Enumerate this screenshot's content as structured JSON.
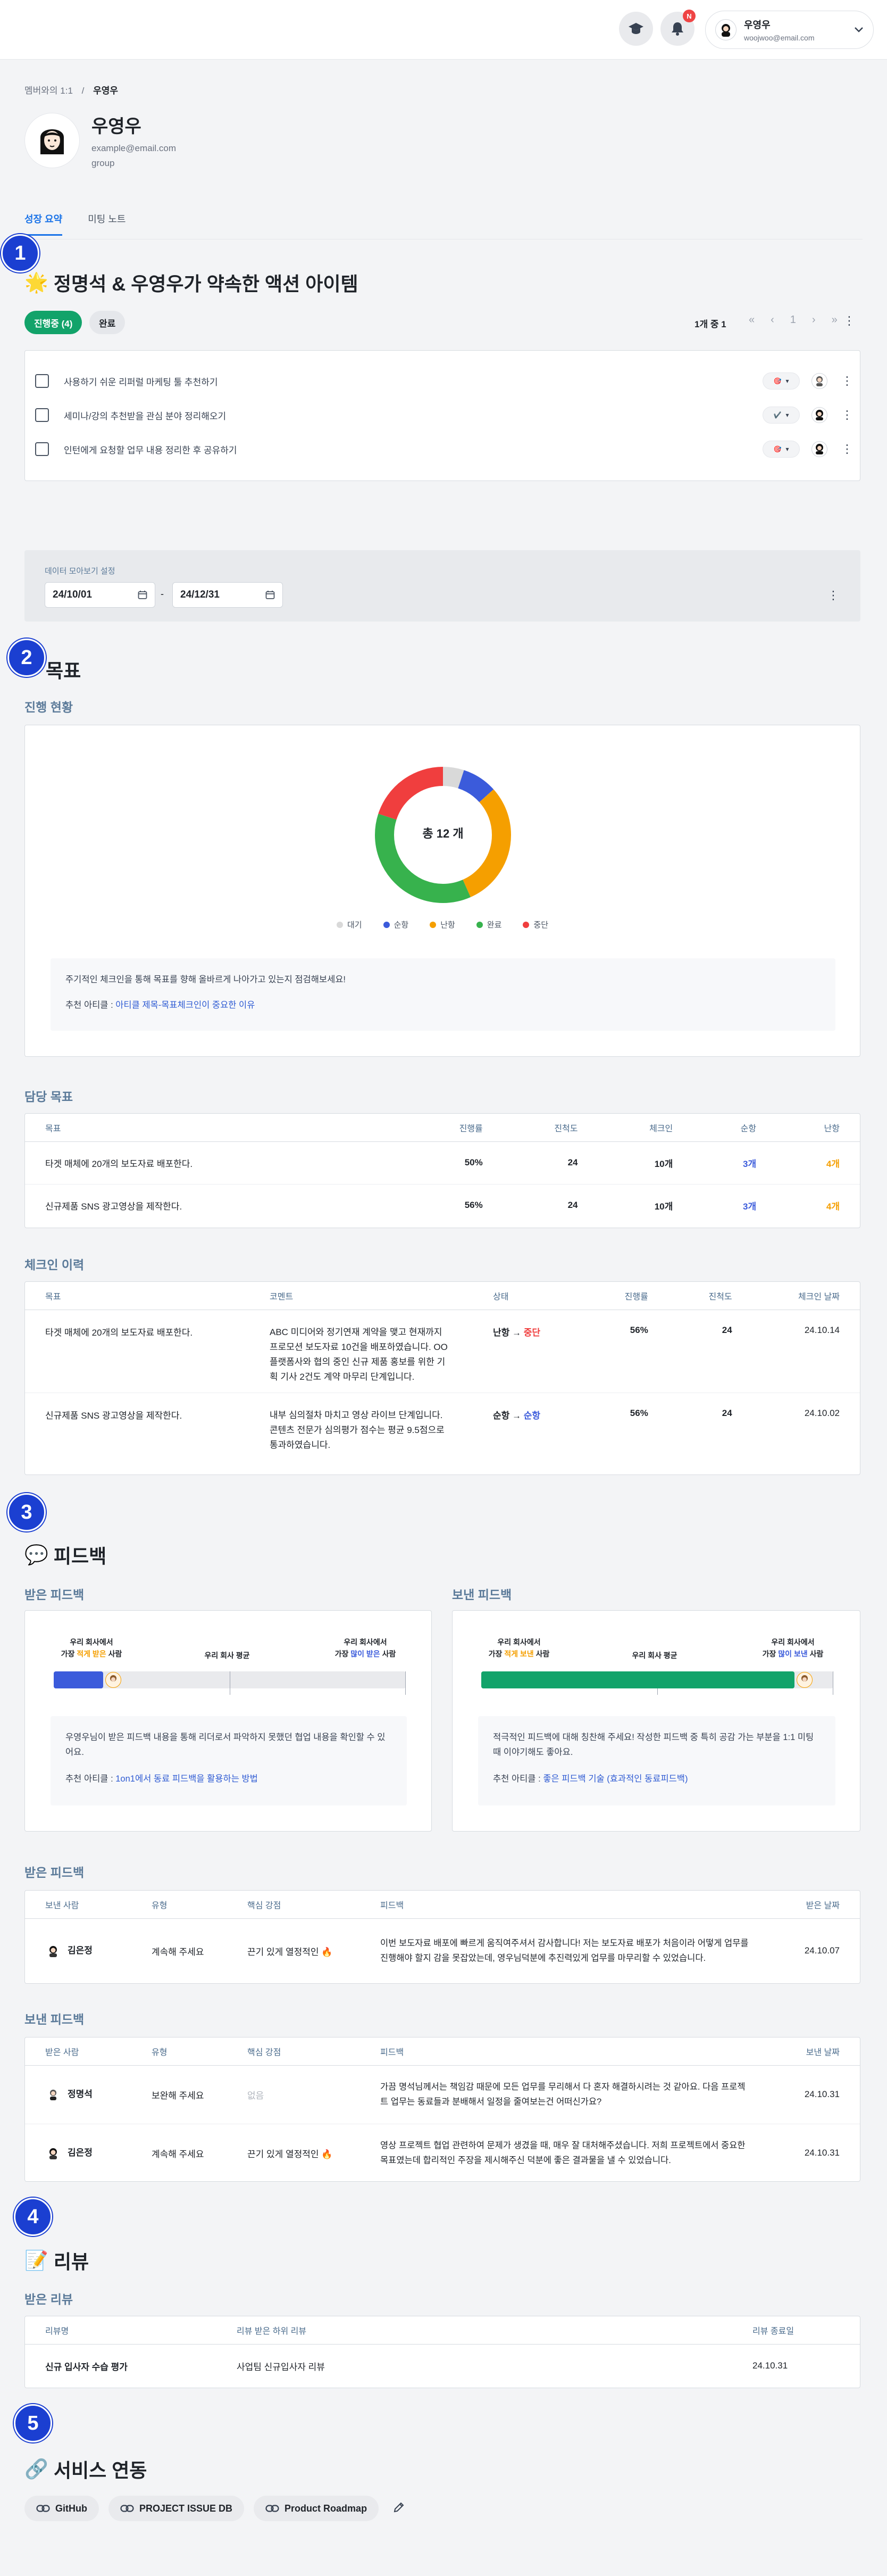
{
  "header": {
    "notification_count": "N",
    "user_name": "우영우",
    "user_email": "woojwoo@email.com"
  },
  "breadcrumb": {
    "parent": "멤버와의 1:1",
    "separator": "/",
    "current": "우영우"
  },
  "profile": {
    "name": "우영우",
    "email": "example@email.com",
    "group": "group"
  },
  "tabs": [
    {
      "label": "성장 요약",
      "active": true
    },
    {
      "label": "미팅 노트",
      "active": false
    }
  ],
  "badges": [
    "1",
    "2",
    "3",
    "4",
    "5"
  ],
  "actions": {
    "emoji": "🌟",
    "title": "정명석 & 우영우가 약속한 액션 아이템",
    "filter_in_progress": "진행중 (4)",
    "filter_done": "완료",
    "pager_info": "1개 중 1",
    "pager_first": "«",
    "pager_prev": "‹",
    "pager_page": "1",
    "pager_next": "›",
    "pager_last": "»",
    "items": [
      {
        "text": "사용하기 쉬운 리퍼럴 마케팅 툴 추천하기",
        "status_emoji": "🎯",
        "status_color": "#ef4444"
      },
      {
        "text": "세미나/강의 추천받을 관심 분야 정리해오기",
        "status_emoji": "✔️",
        "status_color": "#22a55b"
      },
      {
        "text": "인턴에게 요청할 업무 내용 정리한 후 공유하기",
        "status_emoji": "🎯",
        "status_color": "#ef4444"
      }
    ]
  },
  "data_view": {
    "label": "데이터 모아보기 설정",
    "start_date": "24/10/01",
    "separator": "-",
    "end_date": "24/12/31"
  },
  "goals": {
    "title": "목표",
    "progress_title": "진행 현황",
    "donut_center": "총 12 개",
    "legend": [
      {
        "name": "대기",
        "color": "#d9d9d9"
      },
      {
        "name": "순항",
        "color": "#3b5bdb"
      },
      {
        "name": "난항",
        "color": "#f59f00"
      },
      {
        "name": "완료",
        "color": "#37b24d"
      },
      {
        "name": "중단",
        "color": "#f03e3e"
      }
    ],
    "tip_text": "주기적인 체크인을 통해 목표를 향해 올바르게 나아가고 있는지 점검해보세요!",
    "tip_rec_label": "추천 아티클 : ",
    "tip_rec_link": "아티클 제목-목표체크인이 중요한 이유",
    "assigned_title": "담당 목표",
    "assigned_headers": [
      "목표",
      "진행률",
      "진척도",
      "체크인",
      "순항",
      "난항"
    ],
    "assigned_rows": [
      {
        "goal": "타겟 매체에 20개의 보도자료 배포한다.",
        "progress": "50%",
        "score": "24",
        "checkins": "10개",
        "smooth": "3개",
        "rough": "4개"
      },
      {
        "goal": "신규제품 SNS 광고영상을 제작한다.",
        "progress": "56%",
        "score": "24",
        "checkins": "10개",
        "smooth": "3개",
        "rough": "4개"
      }
    ],
    "checkin_title": "체크인 이력",
    "checkin_headers": [
      "목표",
      "코멘트",
      "상태",
      "진행률",
      "진척도",
      "체크인 날짜"
    ],
    "checkin_rows": [
      {
        "goal": "타겟 매체에 20개의 보도자료 배포한다.",
        "comment": "ABC 미디어와 정기연재 계약을 맺고 현재까지 프로모션 보도자료 10건을 배포하였습니다. OO플랫폼사와 협의 중인 신규 제품 홍보를 위한 기획 기사 2건도 계약 마무리 단계입니다.",
        "from": "난항",
        "arrow": "→",
        "to": "중단",
        "progress": "56%",
        "score": "24",
        "date": "24.10.14"
      },
      {
        "goal": "신규제품 SNS 광고영상을 제작한다.",
        "comment": "내부 심의절차 마치고 영상 라이브 단계입니다. 콘텐츠 전문가 심의평가 점수는 평균 9.5점으로 통과하였습니다.",
        "from": "순항",
        "arrow": "→",
        "to": "순항",
        "progress": "56%",
        "score": "24",
        "date": "24.10.02"
      }
    ]
  },
  "feedback": {
    "emoji": "💬",
    "title": "피드백",
    "received_title": "받은 피드백",
    "sent_title": "보낸 피드백",
    "received_bar": {
      "left_label_1": "우리 회사에서",
      "left_label_2a": "가장 ",
      "left_label_2b": "적게 받은",
      "left_label_2c": " 사람",
      "mid_label": "우리 회사 평균",
      "right_label_1": "우리 회사에서",
      "right_label_2a": "가장 ",
      "right_label_2b": "많이 받은",
      "right_label_2c": " 사람",
      "fill_fraction": 0.14,
      "color": "#3b5bdb"
    },
    "sent_bar": {
      "left_label_1": "우리 회사에서",
      "left_label_2a": "가장 ",
      "left_label_2b": "적게 보낸",
      "left_label_2c": " 사람",
      "mid_label": "우리 회사 평균",
      "right_label_1": "우리 회사에서",
      "right_label_2a": "가장 ",
      "right_label_2b": "많이 보낸",
      "right_label_2c": " 사람",
      "fill_fraction": 0.89,
      "color": "#12a36a"
    },
    "received_tip": "우영우님이 받은 피드백 내용을 통해 리더로서 파악하지 못했던 협업 내용을 확인할 수 있어요.",
    "received_rec_label": "추천 아티클 : ",
    "received_rec_link": "1on1에서 동료 피드백을 활용하는 방법",
    "sent_tip": "적극적인 피드백에 대해 칭찬해 주세요! 작성한 피드백 중 특히 공감 가는 부분을 1:1 미팅 때 이야기해도 좋아요.",
    "sent_rec_label": "추천 아티클 : ",
    "sent_rec_link": "좋은 피드백 기술 (효과적인 동료피드백)",
    "received_table_title": "받은 피드백",
    "received_headers": [
      "보낸 사람",
      "유형",
      "핵심 강점",
      "피드백",
      "받은 날짜"
    ],
    "received_rows": [
      {
        "person": "김은정",
        "type": "계속해 주세요",
        "strength": "끈기 있게 열정적인 🔥",
        "strength_muted": false,
        "text": "이번 보도자료 배포에 빠르게 움직여주셔서 감사합니다! 저는 보도자료 배포가 처음이라 어떻게 업무를 진행해야 할지 감을 못잡았는데, 영우님덕분에 추진력있게 업무를 마무리할 수 있었습니다.",
        "date": "24.10.07"
      }
    ],
    "sent_table_title": "보낸 피드백",
    "sent_headers": [
      "받은 사람",
      "유형",
      "핵심 강점",
      "피드백",
      "보낸 날짜"
    ],
    "sent_rows": [
      {
        "person": "정명석",
        "type": "보완해 주세요",
        "strength": "없음",
        "strength_muted": true,
        "text": "가끔 명석님께서는 책임감 때문에 모든 업무를 무리해서 다 혼자 해결하시려는 것 같아요. 다음 프로젝트 업무는 동료들과 분배해서 일정을 줄여보는건 어떠신가요?",
        "date": "24.10.31"
      },
      {
        "person": "김은정",
        "type": "계속해 주세요",
        "strength": "끈기 있게 열정적인 🔥",
        "strength_muted": false,
        "text": "영상 프로젝트 협업 관련하여 문제가 생겼을 때, 매우 잘 대처해주셨습니다. 저희 프로젝트에서 중요한 목표였는데 합리적인 주장을 제시해주신 덕분에 좋은 결과물을 낼 수 있었습니다.",
        "date": "24.10.31"
      }
    ]
  },
  "review": {
    "emoji": "📝",
    "title": "리뷰",
    "sub_title": "받은 리뷰",
    "headers": [
      "리뷰명",
      "리뷰 받은 하위 리뷰",
      "리뷰 종료일"
    ],
    "rows": [
      {
        "name": "신규 입사자 수습 평가",
        "sub": "사업팀 신규입사자 리뷰",
        "end": "24.10.31"
      }
    ]
  },
  "services": {
    "emoji": "🔗",
    "title": "서비스 연동",
    "items": [
      "GitHub",
      "PROJECT ISSUE DB",
      "Product Roadmap"
    ]
  },
  "chart_data": {
    "type": "pie",
    "title": "",
    "center_label": "총 12 개",
    "categories": [
      "대기",
      "순항",
      "난항",
      "완료",
      "중단"
    ],
    "values": [
      0.6,
      1,
      3.6,
      4.4,
      2.4
    ]
  }
}
